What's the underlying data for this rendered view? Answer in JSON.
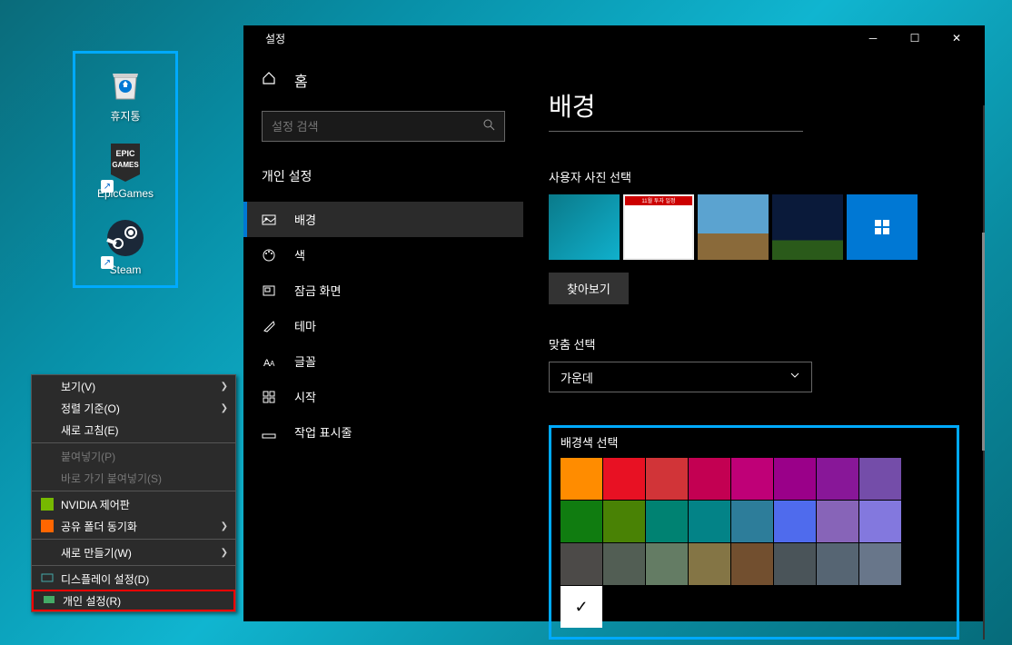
{
  "desktop": {
    "icons": [
      {
        "name": "recycle-bin",
        "label": "휴지통"
      },
      {
        "name": "epic-games",
        "label": "EpicGames"
      },
      {
        "name": "steam",
        "label": "Steam"
      }
    ]
  },
  "context_menu": {
    "items": [
      {
        "label": "보기(V)",
        "has_submenu": true
      },
      {
        "label": "정렬 기준(O)",
        "has_submenu": true
      },
      {
        "label": "새로 고침(E)"
      },
      {
        "sep": true
      },
      {
        "label": "붙여넣기(P)",
        "disabled": true
      },
      {
        "label": "바로 가기 붙여넣기(S)",
        "disabled": true
      },
      {
        "sep": true
      },
      {
        "label": "NVIDIA 제어판",
        "icon": "nvidia"
      },
      {
        "label": "공유 폴더 동기화",
        "icon": "sync",
        "has_submenu": true
      },
      {
        "sep": true
      },
      {
        "label": "새로 만들기(W)",
        "has_submenu": true
      },
      {
        "sep": true
      },
      {
        "label": "디스플레이 설정(D)",
        "icon": "display"
      },
      {
        "label": "개인 설정(R)",
        "icon": "personalize",
        "highlighted": true
      }
    ]
  },
  "settings": {
    "window_title": "설정",
    "home_label": "홈",
    "search_placeholder": "설정 검색",
    "section_title": "개인 설정",
    "nav": [
      {
        "icon": "image",
        "label": "배경",
        "active": true
      },
      {
        "icon": "palette",
        "label": "색"
      },
      {
        "icon": "lock",
        "label": "잠금 화면"
      },
      {
        "icon": "theme",
        "label": "테마"
      },
      {
        "icon": "font",
        "label": "글꼴"
      },
      {
        "icon": "start",
        "label": "시작"
      },
      {
        "icon": "taskbar",
        "label": "작업 표시줄"
      }
    ],
    "page_title": "배경",
    "photo_section_label": "사용자 사진 선택",
    "browse_label": "찾아보기",
    "fit_label": "맞춤 선택",
    "fit_value": "가운데",
    "color_section_label": "배경색 선택",
    "colors": [
      "#ff8c00",
      "#e81123",
      "#d13438",
      "#c30052",
      "#bf0077",
      "#9a0089",
      "#881798",
      "#744da9",
      "#107c10",
      "#498205",
      "#008272",
      "#038387",
      "#2d7d9a",
      "#4f6bed",
      "#8764b8",
      "#8378de",
      "#4c4a48",
      "#525e54",
      "#647c64",
      "#847545",
      "#724f2f",
      "#4a5459",
      "#566573",
      "#68768a",
      "#ffffff"
    ],
    "thumbnails": [
      {
        "bg": "linear-gradient(135deg,#0a7a8a,#10b0cc)"
      },
      {
        "bg": "#f0f0f0"
      },
      {
        "bg": "linear-gradient(180deg,#5ba3d0 60%,#8a6a3a 60%)"
      },
      {
        "bg": "linear-gradient(180deg,#0a1a3a 70%,#2a5a1a 70%)"
      },
      {
        "bg": "#0078d4"
      }
    ]
  }
}
